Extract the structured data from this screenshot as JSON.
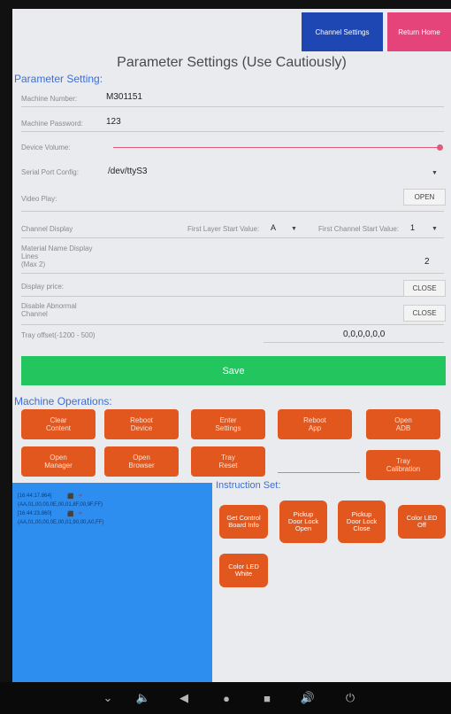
{
  "topbar": {
    "channel_settings": "Channel Settings",
    "return_home": "Return Home"
  },
  "page_title": "Parameter Settings (Use Cautiously)",
  "parameter_section": "Parameter Setting:",
  "params": {
    "machine_number_label": "Machine Number:",
    "machine_number_value": "M301151",
    "machine_password_label": "Machine Password:",
    "machine_password_value": "123",
    "device_volume_label": "Device Volume:",
    "device_volume_level": 1.0,
    "serial_port_label": "Serial Port Config:",
    "serial_port_value": "/dev/ttyS3",
    "video_play_label": "Video Play:",
    "video_play_button": "OPEN",
    "channel_display_label": "Channel Display",
    "first_layer_label": "First Layer Start Value:",
    "first_layer_value": "A",
    "first_channel_label": "First Channel Start Value:",
    "first_channel_value": "1",
    "material_name_label_1": "Material Name Display",
    "material_name_label_2": "Lines",
    "material_name_label_3": "(Max 2)",
    "material_name_value": "2",
    "display_price_label": "Display price:",
    "display_price_button": "CLOSE",
    "disable_abnormal_label_1": "Disable Abnormal",
    "disable_abnormal_label_2": "Channel",
    "disable_abnormal_button": "CLOSE",
    "tray_offset_label": "Tray offset(-1200 - 500)",
    "tray_offset_value": "0,0,0,0,0,0"
  },
  "save_label": "Save",
  "operations_section": "Machine Operations:",
  "operations": {
    "clear_content": [
      "Clear",
      "Content"
    ],
    "reboot_device": [
      "Reboot",
      "Device"
    ],
    "enter_settings": [
      "Enter",
      "Settings"
    ],
    "reboot_app": [
      "Reboot",
      "App"
    ],
    "open_adb": [
      "Open",
      "ADB"
    ],
    "open_manager": [
      "Open",
      "Manager"
    ],
    "open_browser": [
      "Open",
      "Browser"
    ],
    "tray_reset": [
      "Tray",
      "Reset"
    ],
    "tray_calibration": [
      "Tray",
      "Calibration"
    ]
  },
  "log": {
    "line1": "[16:44:17.864] ",
    "line2": "(AA,01,00,00,0E,00,01,8F,00,9F,FF)",
    "line3": "[16:44:23.860] ",
    "line4": "(AA,01,00,00,0E,00,01,90,00,A0,FF)"
  },
  "instruction_section": "Instruction Set:",
  "instructions": {
    "get_control": [
      "Get Control",
      "Board Info"
    ],
    "pickup_open": [
      "Pickup",
      "Door Lock",
      "Open"
    ],
    "pickup_close": [
      "Pickup",
      "Door Lock",
      "Close"
    ],
    "led_off": [
      "Color LED",
      "Off"
    ],
    "led_white": [
      "Color LED",
      "White"
    ]
  },
  "colors": {
    "channel_btn": "#1f47b3",
    "home_btn": "#e5447a",
    "save": "#22c55e",
    "orange": "#e2571e",
    "log_bg": "#2e8ef0",
    "section_title": "#3b6fd8"
  }
}
